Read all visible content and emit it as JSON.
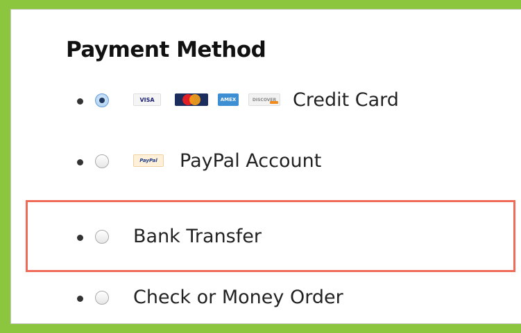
{
  "title": "Payment Method",
  "options": [
    {
      "label": "Credit Card",
      "selected": true,
      "icons": [
        "visa-icon",
        "mastercard-icon",
        "amex-icon",
        "discover-icon"
      ]
    },
    {
      "label": "PayPal Account",
      "selected": false,
      "icons": [
        "paypal-icon"
      ]
    },
    {
      "label": "Bank Transfer",
      "selected": false,
      "highlighted": true
    },
    {
      "label": "Check or Money Order",
      "selected": false
    }
  ],
  "card_labels": {
    "visa": "VISA",
    "amex": "AMEX",
    "discover": "DISCOVER",
    "paypal": "PayPal"
  },
  "colors": {
    "frame": "#8cc63f",
    "highlight": "#ef6b57",
    "selected_radio": "#9fc7ee"
  }
}
